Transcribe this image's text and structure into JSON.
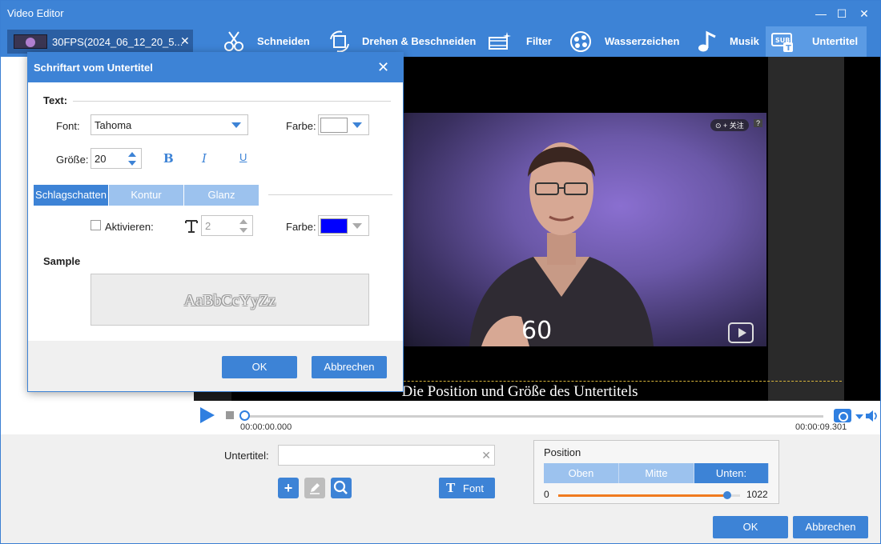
{
  "window": {
    "title": "Video Editor",
    "controls": [
      "—",
      "☐",
      "✕"
    ]
  },
  "file_tab": {
    "name": "30FPS(2024_06_12_20_5...",
    "close": "✕"
  },
  "tools": [
    {
      "id": "schneiden",
      "label": "Schneiden",
      "icon": "scissors-icon"
    },
    {
      "id": "drehen",
      "label": "Drehen & Beschneiden",
      "icon": "rotate-crop-icon"
    },
    {
      "id": "filter",
      "label": "Filter",
      "icon": "film-sparkle-icon"
    },
    {
      "id": "wasserzeichen",
      "label": "Wasserzeichen",
      "icon": "watermark-icon"
    },
    {
      "id": "musik",
      "label": "Musik",
      "icon": "music-note-icon"
    },
    {
      "id": "untertitel",
      "label": "Untertitel",
      "icon": "subtitle-icon",
      "active": true
    }
  ],
  "video": {
    "overlay_number": "60",
    "watermark_badge": "⊙ + 关注",
    "qm_badge": "?",
    "subtitle_text": "Die Position und Größe des Untertitels"
  },
  "player": {
    "current_time": "00:00:00.000",
    "total_time": "00:00:09.301",
    "progress": 0
  },
  "bottom": {
    "subtitle_label": "Untertitel:",
    "subtitle_value": "",
    "clear": "✕",
    "buttons": {
      "add": "+",
      "edit": "✎",
      "search": "🔍"
    },
    "font_button": {
      "icon": "T",
      "label": "Font"
    },
    "position": {
      "title": "Position",
      "options": [
        "Oben",
        "Mitte",
        "Unten:"
      ],
      "selected": "Unten:",
      "min": "0",
      "max": "1022",
      "value_fraction": 0.93
    },
    "ok": "OK",
    "cancel": "Abbrechen"
  },
  "dialog": {
    "title": "Schriftart vom Untertitel",
    "close": "✕",
    "text_section": "Text:",
    "font_label": "Font:",
    "font_value": "Tahoma",
    "color_label": "Farbe:",
    "text_color": "#ffffff",
    "size_label": "Größe:",
    "size_value": "20",
    "bold": "B",
    "italic": "I",
    "underline": "U",
    "tabs": [
      "Schlagschatten",
      "Kontur",
      "Glanz"
    ],
    "active_tab": "Schlagschatten",
    "enable_label": "Aktivieren:",
    "enable_checked": false,
    "shadow_size": "2",
    "shadow_color_label": "Farbe:",
    "shadow_color": "#0000ff",
    "sample_title": "Sample",
    "sample_text": "AaBbCcYyZz",
    "ok": "OK",
    "cancel": "Abbrechen"
  },
  "colors": {
    "accent": "#3d83d6",
    "accent_light": "#9cc2ee",
    "slider_fill": "#f07a1f"
  }
}
